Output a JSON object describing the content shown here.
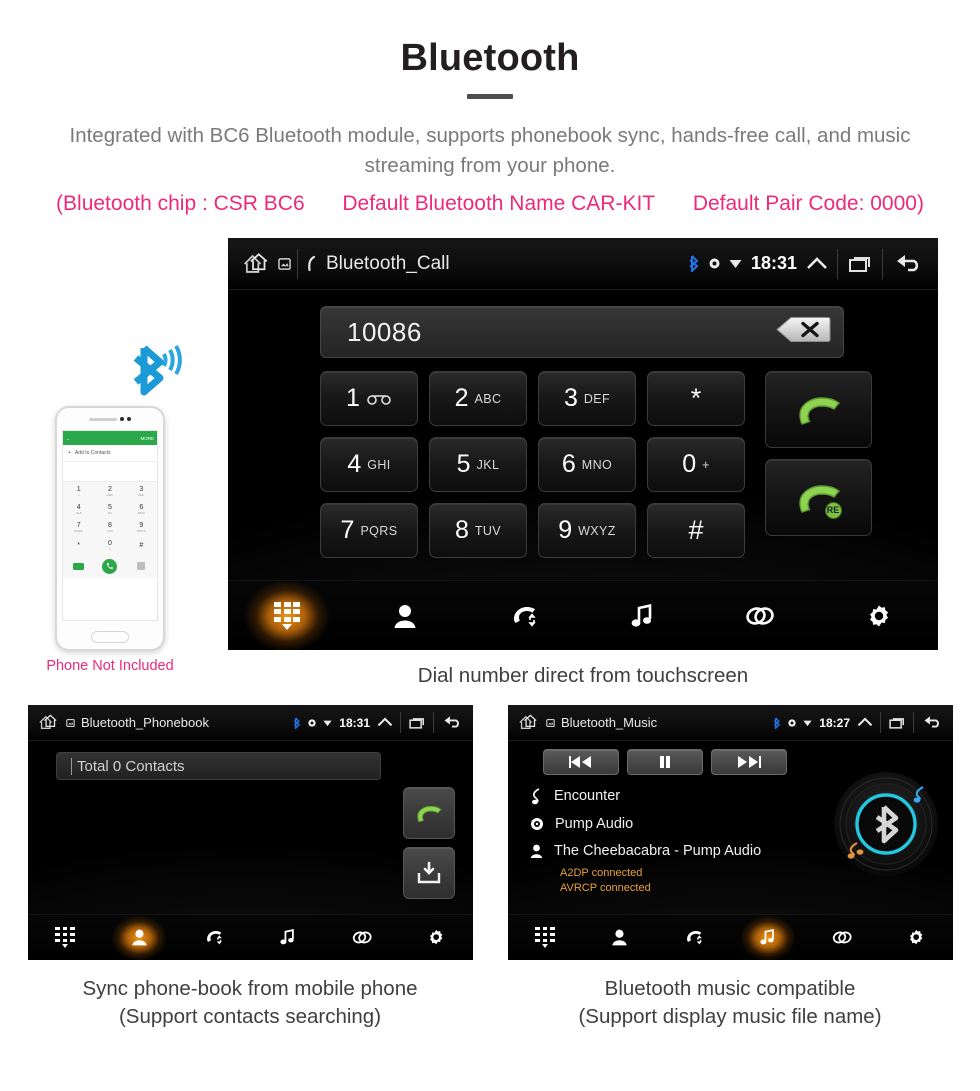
{
  "header": {
    "title": "Bluetooth",
    "subtitle": "Integrated with BC6 Bluetooth module, supports phonebook sync, hands-free call, and music streaming from your phone.",
    "chip_info": "(Bluetooth chip : CSR BC6",
    "default_name": "Default Bluetooth Name CAR-KIT",
    "pair_code": "Default Pair Code: 0000)",
    "accent_color": "#ec2a7b",
    "text_color": "#7a7a7a"
  },
  "phone_mock": {
    "note": "Phone Not Included",
    "screen": {
      "more_label": "MORE",
      "add_contact_label": "Add to Contacts",
      "keys": [
        {
          "num": "1",
          "sub": "∞"
        },
        {
          "num": "2",
          "sub": "ABC"
        },
        {
          "num": "3",
          "sub": "DEF"
        },
        {
          "num": "4",
          "sub": "GHI"
        },
        {
          "num": "5",
          "sub": "JKL"
        },
        {
          "num": "6",
          "sub": "MNO"
        },
        {
          "num": "7",
          "sub": "PQRS"
        },
        {
          "num": "8",
          "sub": "TUV"
        },
        {
          "num": "9",
          "sub": "WXYZ"
        },
        {
          "num": "*",
          "sub": ""
        },
        {
          "num": "0",
          "sub": "+"
        },
        {
          "num": "#",
          "sub": ""
        }
      ]
    }
  },
  "dialer": {
    "statusbar": {
      "title": "Bluetooth_Call",
      "time": "18:31",
      "bluetooth_color": "#1f6feb"
    },
    "number_field": {
      "value": "10086",
      "backspace_label": "backspace"
    },
    "keys": [
      {
        "big": "1",
        "sub": "",
        "icon": "voicemail"
      },
      {
        "big": "2",
        "sub": "ABC",
        "icon": ""
      },
      {
        "big": "3",
        "sub": "DEF",
        "icon": ""
      },
      {
        "big": "*",
        "sub": "",
        "icon": ""
      },
      {
        "big": "4",
        "sub": "GHI",
        "icon": ""
      },
      {
        "big": "5",
        "sub": "JKL",
        "icon": ""
      },
      {
        "big": "6",
        "sub": "MNO",
        "icon": ""
      },
      {
        "big": "0",
        "sub": "+",
        "icon": ""
      },
      {
        "big": "7",
        "sub": "PQRS",
        "icon": ""
      },
      {
        "big": "8",
        "sub": "TUV",
        "icon": ""
      },
      {
        "big": "9",
        "sub": "WXYZ",
        "icon": ""
      },
      {
        "big": "#",
        "sub": "",
        "icon": ""
      }
    ],
    "call_button": "call",
    "redial_button": "redial",
    "redial_badge": "RE",
    "caption": "Dial number direct from touchscreen",
    "nav": [
      {
        "name": "keypad",
        "active": true
      },
      {
        "name": "contacts",
        "active": false
      },
      {
        "name": "call-history",
        "active": false
      },
      {
        "name": "music",
        "active": false
      },
      {
        "name": "pair",
        "active": false
      },
      {
        "name": "settings",
        "active": false
      }
    ]
  },
  "phonebook": {
    "statusbar": {
      "title": "Bluetooth_Phonebook",
      "time": "18:31"
    },
    "search_value": "Total 0 Contacts",
    "buttons": [
      {
        "name": "call",
        "label": "call"
      },
      {
        "name": "download-contacts",
        "label": "download"
      }
    ],
    "caption_line1": "Sync phone-book from mobile phone",
    "caption_line2": "(Support contacts searching)",
    "nav": [
      {
        "name": "keypad",
        "active": false
      },
      {
        "name": "contacts",
        "active": true
      },
      {
        "name": "call-history",
        "active": false
      },
      {
        "name": "music",
        "active": false
      },
      {
        "name": "pair",
        "active": false
      },
      {
        "name": "settings",
        "active": false
      }
    ]
  },
  "music": {
    "statusbar": {
      "title": "Bluetooth_Music",
      "time": "18:27"
    },
    "transport": [
      {
        "name": "previous",
        "glyph": "◀◀"
      },
      {
        "name": "pause",
        "glyph": "❚❚"
      },
      {
        "name": "next",
        "glyph": "▶▶"
      }
    ],
    "track": {
      "title": "Encounter",
      "album": "Pump Audio",
      "artist": "The Cheebacabra - Pump Audio"
    },
    "status": [
      "A2DP connected",
      "AVRCP connected"
    ],
    "status_color": "#e8a13a",
    "caption_line1": "Bluetooth music compatible",
    "caption_line2": "(Support display music file name)",
    "nav": [
      {
        "name": "keypad",
        "active": false
      },
      {
        "name": "contacts",
        "active": false
      },
      {
        "name": "call-history",
        "active": false
      },
      {
        "name": "music",
        "active": true
      },
      {
        "name": "pair",
        "active": false
      },
      {
        "name": "settings",
        "active": false
      }
    ]
  }
}
